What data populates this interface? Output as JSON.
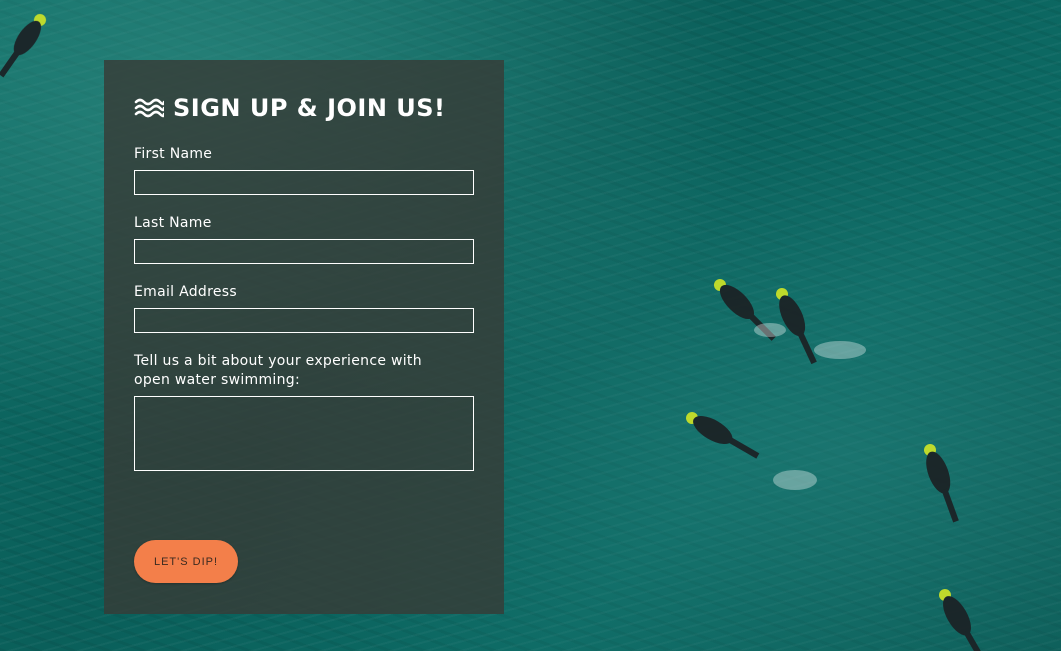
{
  "form": {
    "title": "SIGN UP & JOIN US!",
    "title_icon": "waves-icon",
    "fields": [
      {
        "label": "First Name",
        "value": "",
        "type": "text"
      },
      {
        "label": "Last Name",
        "value": "",
        "type": "text"
      },
      {
        "label": "Email Address",
        "value": "",
        "type": "email"
      },
      {
        "label": "Tell us a bit about your experience with open water swimming:",
        "value": "",
        "type": "textarea"
      }
    ],
    "submit_label": "LET'S DIP!"
  },
  "colors": {
    "accent": "#f37f4a",
    "panel": "#373c37",
    "water": "#0c6a64"
  }
}
